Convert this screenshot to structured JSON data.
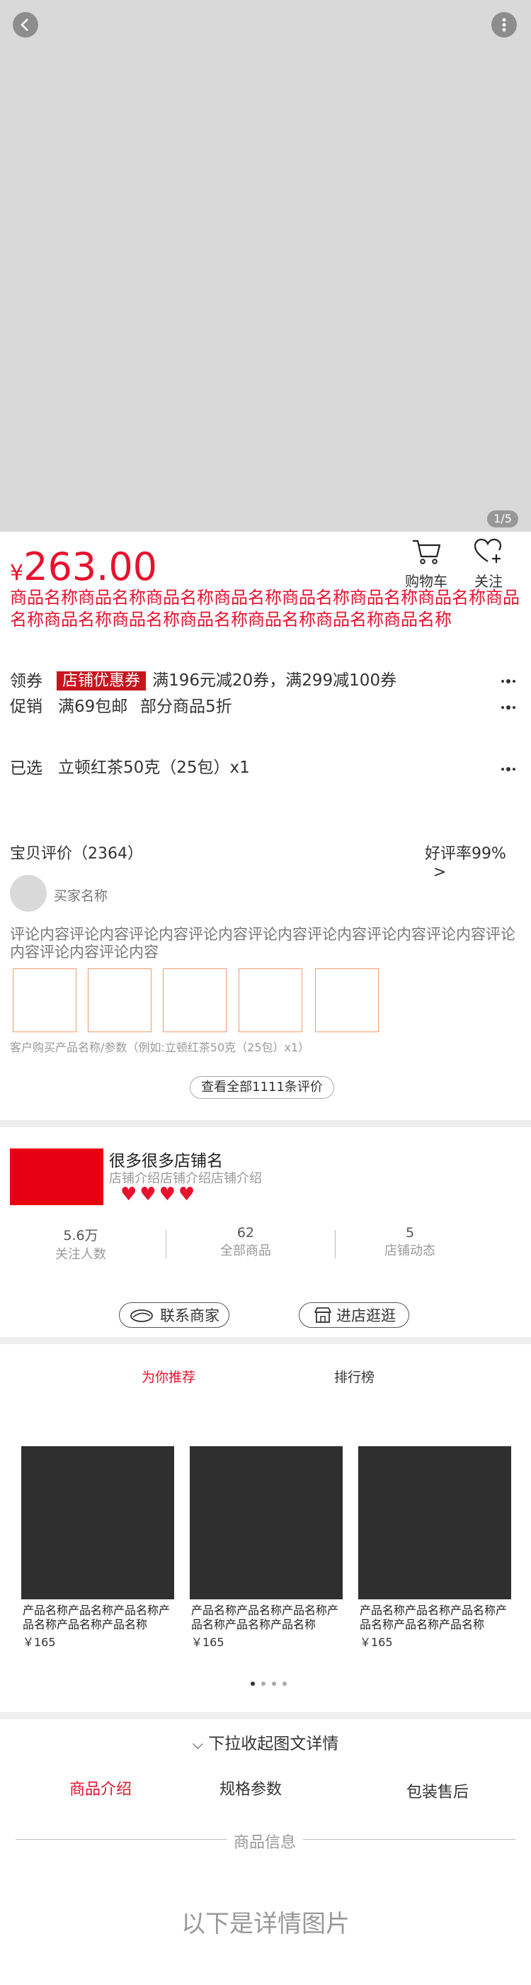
{
  "gallery": {
    "pager": "1/5"
  },
  "product": {
    "currency": "¥",
    "price": "263.00",
    "title": "商品名称商品名称商品名称商品名称商品名称商品名称商品名称商品名称商品名称商品名称商品名称商品名称商品名称商品名称"
  },
  "top_actions": {
    "cart": "购物车",
    "follow": "关注"
  },
  "coupon": {
    "label": "领券",
    "badge": "店铺优惠券",
    "text": "满196元减20券，满299减100券"
  },
  "promo": {
    "label": "促销",
    "items": [
      "满69包邮",
      "部分商品5折"
    ]
  },
  "selected": {
    "label": "已选",
    "value": "立顿红茶50克（25包）x1"
  },
  "reviews": {
    "title": "宝贝评价（2364）",
    "rating": "好评率99%",
    "arrow": ">",
    "buyer": "买家名称",
    "content": "评论内容评论内容评论内容评论内容评论内容评论内容评论内容评论内容评论内容评论内容评论内容",
    "spec": "客户购买产品名称/参数（例如:立顿红茶50克（25包）x1）",
    "view_all": "查看全部1111条评价"
  },
  "shop": {
    "name": "很多很多店铺名",
    "intro": "店铺介绍店铺介绍店铺介绍",
    "hearts": "♥♥♥♥",
    "stats": [
      {
        "num": "5.6万",
        "label": "关注人数"
      },
      {
        "num": "62",
        "label": "全部商品"
      },
      {
        "num": "5",
        "label": "店铺动态"
      }
    ],
    "contact": "联系商家",
    "visit": "进店逛逛"
  },
  "recommend": {
    "tabs": [
      "为你推荐",
      "排行榜"
    ],
    "items": [
      {
        "name": "产品名称产品名称产品名称产品名称产品名称产品名称",
        "price": "￥165"
      },
      {
        "name": "产品名称产品名称产品名称产品名称产品名称产品名称",
        "price": "￥165"
      },
      {
        "name": "产品名称产品名称产品名称产品名称产品名称产品名称",
        "price": "￥165"
      }
    ]
  },
  "detail": {
    "pull": "下拉收起图文详情",
    "tabs": [
      "商品介绍",
      "规格参数",
      "包装售后"
    ],
    "info": "商品信息",
    "note": "以下是详情图片"
  },
  "colors": {
    "accent": "#e8112e",
    "badge": "#c8151d",
    "shop_logo": "#e60012"
  }
}
